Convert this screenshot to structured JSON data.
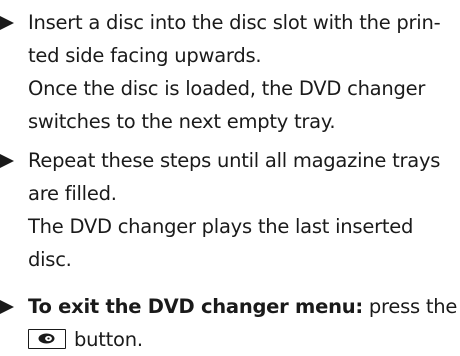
{
  "steps": [
    {
      "lines": [
        "Insert a disc into the disc slot with the prin-",
        "ted side facing upwards.",
        "Once the disc is loaded, the DVD changer",
        "switches to the next empty tray."
      ]
    },
    {
      "lines": [
        "Repeat these steps until all magazine trays",
        "are filled.",
        "The DVD changer plays the last inserted",
        "disc."
      ]
    },
    {
      "bold": "To exit the DVD changer menu:",
      "after_bold": " press the",
      "button_suffix": "button.",
      "button_icon": "eject-disc-icon"
    }
  ]
}
